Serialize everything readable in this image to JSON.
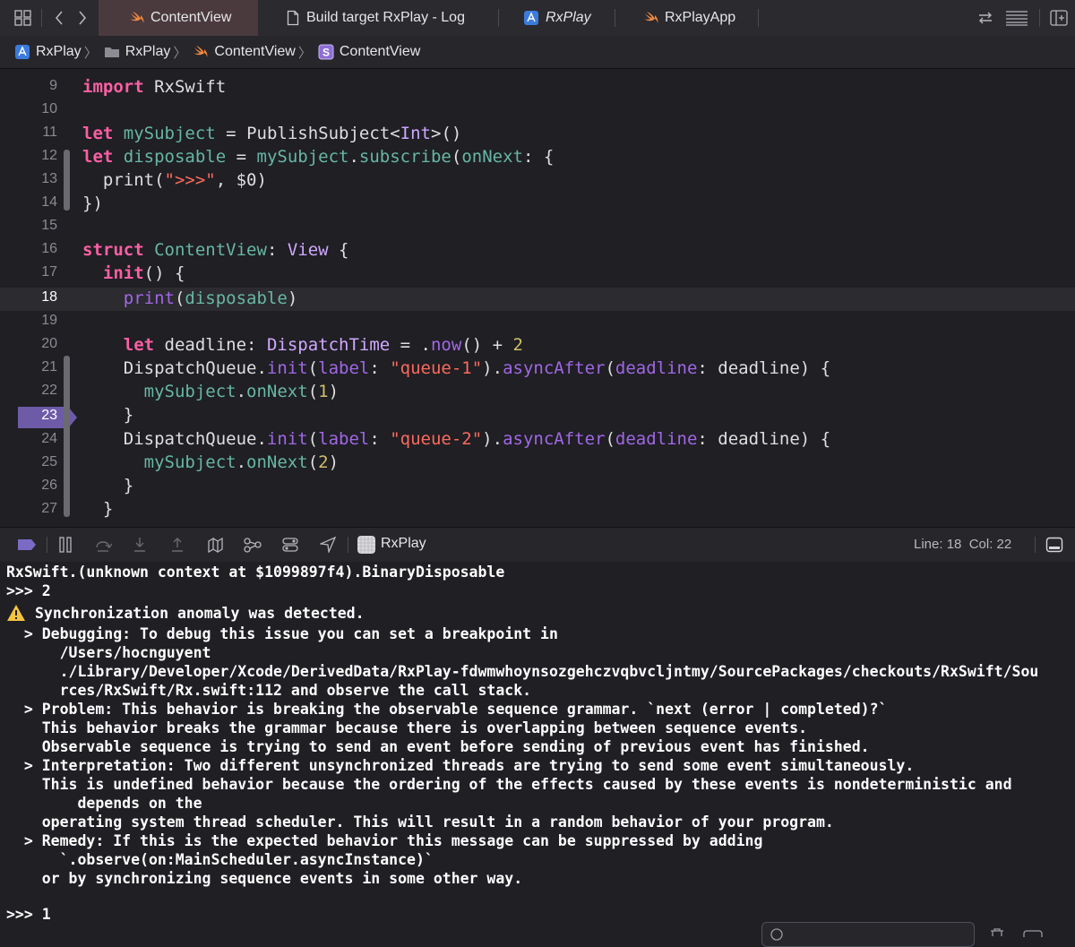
{
  "tabs": [
    {
      "label": "ContentView"
    },
    {
      "label": "Build target RxPlay - Log"
    },
    {
      "label": "RxPlay"
    },
    {
      "label": "RxPlayApp"
    }
  ],
  "breadcrumb": [
    "RxPlay",
    "RxPlay",
    "ContentView",
    "ContentView"
  ],
  "editor": {
    "current_line": 18,
    "breakpoint_line": 23,
    "line_numbers": [
      "9",
      "10",
      "11",
      "12",
      "13",
      "14",
      "15",
      "16",
      "17",
      "18",
      "19",
      "20",
      "21",
      "22",
      "23",
      "24",
      "25",
      "26",
      "27"
    ],
    "code": {
      "l9": [
        "import",
        " RxSwift"
      ],
      "l11": [
        "let",
        " ",
        "mySubject",
        " = ",
        "PublishSubject",
        "<",
        "Int",
        ">()"
      ],
      "l12": [
        "let",
        " ",
        "disposable",
        " = ",
        "mySubject",
        ".",
        "subscribe",
        "(",
        "onNext",
        ": {"
      ],
      "l13": [
        "  print(",
        "\">>>\"",
        ", $0)"
      ],
      "l14": [
        "})"
      ],
      "l16": [
        "struct",
        " ",
        "ContentView",
        ": ",
        "View",
        " {"
      ],
      "l17": [
        "  ",
        "init",
        "() {"
      ],
      "l18": [
        "    ",
        "print",
        "(",
        "disposable",
        ")"
      ],
      "l20": [
        "    ",
        "let",
        " deadline: ",
        "DispatchTime",
        " = .",
        "now",
        "() + ",
        "2"
      ],
      "l21": [
        "    DispatchQueue.",
        "init",
        "(",
        "label",
        ": ",
        "\"queue-1\"",
        ").",
        "asyncAfter",
        "(",
        "deadline",
        ": deadline) {"
      ],
      "l22": [
        "      ",
        "mySubject",
        ".",
        "onNext",
        "(",
        "1",
        ")"
      ],
      "l23": [
        "    }"
      ],
      "l24": [
        "    DispatchQueue.",
        "init",
        "(",
        "label",
        ": ",
        "\"queue-2\"",
        ").",
        "asyncAfter",
        "(",
        "deadline",
        ": deadline) {"
      ],
      "l25": [
        "      ",
        "mySubject",
        ".",
        "onNext",
        "(",
        "2",
        ")"
      ],
      "l26": [
        "    }"
      ],
      "l27": [
        "  }"
      ]
    }
  },
  "debugbar": {
    "process": "RxPlay",
    "position": "Line: 18  Col: 22"
  },
  "console": {
    "lines": [
      "RxSwift.(unknown context at $1099897f4).BinaryDisposable",
      ">>> 2",
      "Synchronization anomaly was detected.",
      "  > Debugging: To debug this issue you can set a breakpoint in",
      "      /Users/hocnguyent",
      "      ./Library/Developer/Xcode/DerivedData/RxPlay-fdwmwhoynsozgehczvqbvcljntmy/SourcePackages/checkouts/RxSwift/Sou",
      "      rces/RxSwift/Rx.swift:112 and observe the call stack.",
      "  > Problem: This behavior is breaking the observable sequence grammar. `next (error | completed)?`",
      "    This behavior breaks the grammar because there is overlapping between sequence events.",
      "    Observable sequence is trying to send an event before sending of previous event has finished.",
      "  > Interpretation: Two different unsynchronized threads are trying to send some event simultaneously.",
      "    This is undefined behavior because the ordering of the effects caused by these events is nondeterministic and",
      "        depends on the",
      "    operating system thread scheduler. This will result in a random behavior of your program.",
      "  > Remedy: If this is the expected behavior this message can be suppressed by adding",
      "      `.observe(on:MainScheduler.asyncInstance)`",
      "    or by synchronizing sequence events in some other way.",
      "",
      ">>> 1"
    ]
  },
  "colors": {
    "keyword": "#fc5fa3",
    "type": "#d0a8ff",
    "function": "#67b7a4",
    "property": "#a167e6",
    "string": "#fc6a5d",
    "number": "#d0bf69",
    "active_tab": "#4a3a3e",
    "breakpoint": "#6e5ba8"
  }
}
